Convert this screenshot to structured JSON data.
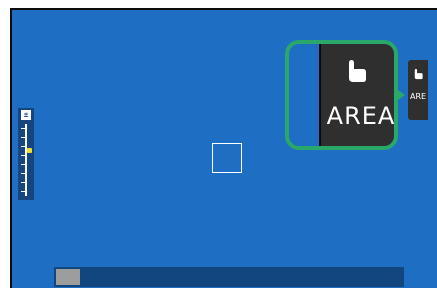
{
  "viewfinder": {
    "background_color": "#1e6ec4",
    "callout_color": "#29a86a"
  },
  "touch_area_button": {
    "label": "AREA",
    "icon": "touch-hand-icon"
  },
  "small_area_button": {
    "label": "ARE",
    "icon": "touch-hand-icon"
  },
  "ev_scale": {
    "icon": "exposure-compensation-icon",
    "icon_text": "±",
    "level": 0.5
  },
  "scrollbar": {
    "position_fraction": 0.0
  }
}
